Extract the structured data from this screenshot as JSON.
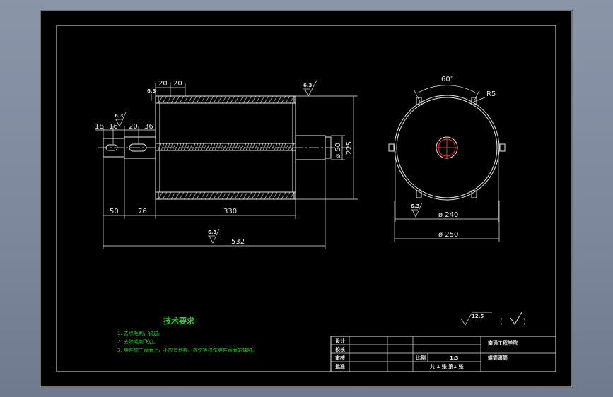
{
  "drawing": {
    "dims_front": {
      "d20a": "20",
      "d20b": "20",
      "d18": "18",
      "d16": "16",
      "d20c": "20",
      "d36": "36",
      "d50_bottom": "50",
      "d76": "76",
      "d330": "330",
      "d532": "532",
      "d_phi50": "ø 50",
      "d225": "225"
    },
    "roughness": {
      "r1": "6.3",
      "r2": "6.3",
      "r3": "6.3",
      "r4": "6.3",
      "r5": "6.3"
    },
    "dims_side": {
      "angle": "60°",
      "radius": "R5",
      "phi240": "ø 240",
      "phi250": "ø 250"
    },
    "tech": {
      "title": "技术要求",
      "items": [
        "1. 去除毛刺，锐边。",
        "2. 去除毛刺飞边。",
        "3. 零件加工表面上，不应有划痕、擦伤等损伤零件表面的缺陷。"
      ]
    },
    "surface_symbol": {
      "value": "12.5",
      "paren_open": "(",
      "paren_close": ")"
    },
    "title_block": {
      "designer": "设计",
      "checker": "校核",
      "reviewer": "审核",
      "approver": "批准",
      "school": "南通工程学院",
      "scale_label": "比例",
      "scale_value": "1:3",
      "part_name": "辊筒滚筒",
      "sheets": "共 1 张 第1 张"
    }
  }
}
